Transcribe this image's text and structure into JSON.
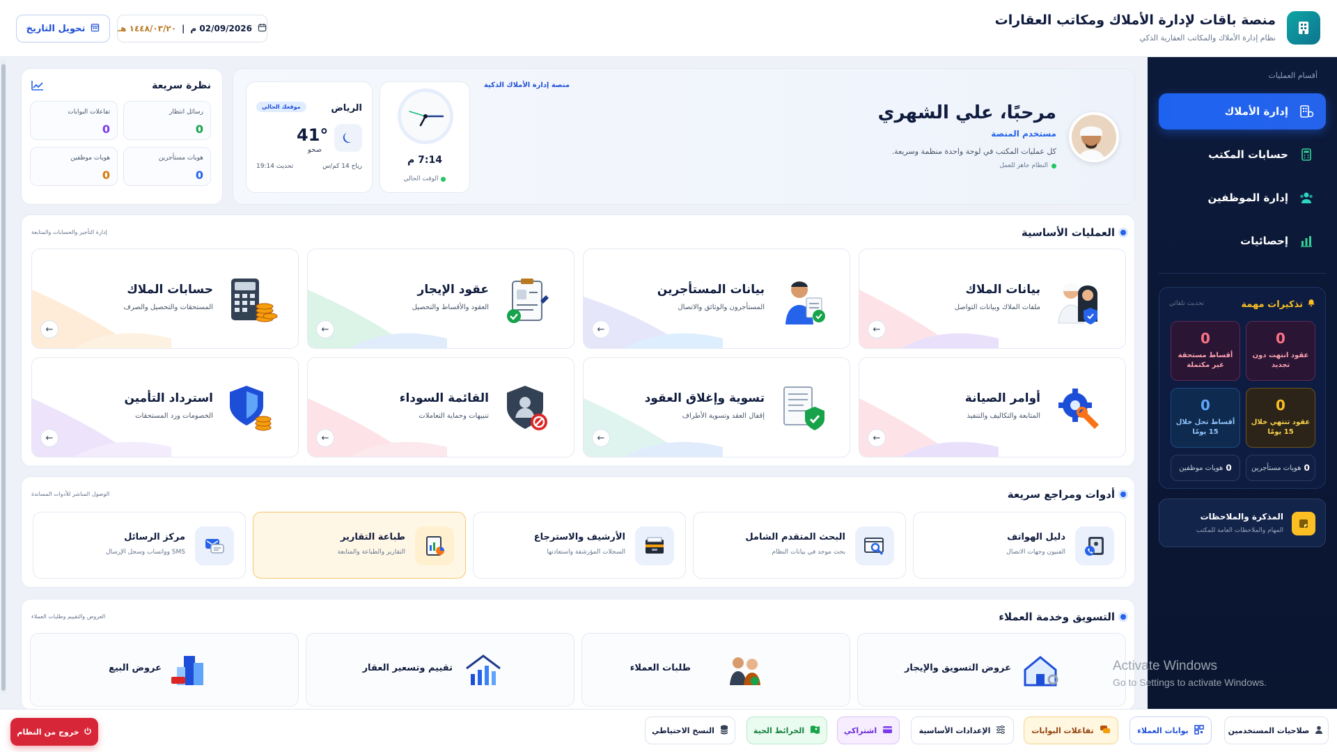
{
  "header": {
    "title": "منصة باقات لإدارة الأملاك ومكاتب العقارات",
    "subtitle": "نظام إدارة الأملاك والمكاتب العقارية الذكي",
    "date_gregorian": "02/09/2026 م",
    "date_separator": "|",
    "date_hijri": "١٤٤٨/٠٣/٢٠ هـ",
    "convert_label": "تحويل التاريخ"
  },
  "sidebar": {
    "caption": "أقسام العمليات",
    "items": [
      {
        "label": "إدارة الأملاك",
        "icon": "building-icon",
        "active": true
      },
      {
        "label": "حسابات المكتب",
        "icon": "calculator-icon",
        "active": false
      },
      {
        "label": "إدارة الموظفين",
        "icon": "users-icon",
        "active": false
      },
      {
        "label": "إحصائيات",
        "icon": "chart-icon",
        "active": false
      }
    ],
    "alerts": {
      "title": "تذكيرات مهمة",
      "note": "تحديث تلقائي",
      "boxes": [
        {
          "value": "0",
          "label": "عقود انتهت دون تجديد"
        },
        {
          "value": "0",
          "label": "أقساط مستحقة غير مكتملة"
        },
        {
          "value": "0",
          "label": "عقود تنتهي خلال 15 يومًا"
        },
        {
          "value": "0",
          "label": "أقساط تحل خلال 15 يومًا"
        }
      ],
      "mini": [
        {
          "value": "0",
          "label": "هويات مستأجرين"
        },
        {
          "value": "0",
          "label": "هويات موظفين"
        }
      ]
    },
    "notes": {
      "title": "المذكرة والملاحظات",
      "subtitle": "المهام والملاحظات العامة للمكتب"
    }
  },
  "welcome": {
    "title": "مرحبًا، علي الشهري",
    "role": "مستخدم المنصة",
    "description": "كل عمليات المكتب في لوحة واحدة منظمة وسريعة.",
    "status": "النظام جاهز للعمل",
    "platform_tag": "منصة إدارة الأملاك الذكية",
    "clock_time": "7:14 م",
    "clock_label": "الوقت الحالي",
    "weather": {
      "city": "الرياض",
      "badge": "موقعك الحالي",
      "temp": "41°",
      "condition": "صحو",
      "wind": "رياح 14 كم/س",
      "updated": "تحديث 19:14"
    }
  },
  "quick": {
    "title": "نظرة سريعة",
    "stats": [
      {
        "label": "رسائل انتظار",
        "value": "0",
        "color": "#16a34a"
      },
      {
        "label": "تفاعلات البوابات",
        "value": "0",
        "color": "#7c3aed"
      },
      {
        "label": "هويات مستأجرين",
        "value": "0",
        "color": "#2563eb"
      },
      {
        "label": "هويات موظفين",
        "value": "0",
        "color": "#d97706"
      }
    ]
  },
  "core": {
    "title": "العمليات الأساسية",
    "note": "إدارة التأجير والحسابات والمتابعة",
    "cards": [
      {
        "title": "بيانات الملاك",
        "subtitle": "ملفات الملاك وبيانات التواصل"
      },
      {
        "title": "بيانات المستأجرين",
        "subtitle": "المستأجرون والوثائق والاتصال"
      },
      {
        "title": "عقود الإيجار",
        "subtitle": "العقود والأقساط والتحصيل"
      },
      {
        "title": "حسابات الملاك",
        "subtitle": "المستحقات والتحصيل والصرف"
      },
      {
        "title": "أوامر الصيانة",
        "subtitle": "المتابعة والتكاليف والتنفيذ"
      },
      {
        "title": "تسوية وإغلاق العقود",
        "subtitle": "إقفال العقد وتسوية الأطراف"
      },
      {
        "title": "القائمة السوداء",
        "subtitle": "تنبيهات وحماية التعاملات"
      },
      {
        "title": "استرداد التأمين",
        "subtitle": "الخصومات ورد المستحقات"
      }
    ]
  },
  "tools": {
    "title": "أدوات ومراجع سريعة",
    "note": "الوصول المباشر للأدوات المساندة",
    "cards": [
      {
        "title": "دليل الهواتف",
        "subtitle": "الفنيون وجهات الاتصال"
      },
      {
        "title": "البحث المتقدم الشامل",
        "subtitle": "بحث موحد في بيانات النظام"
      },
      {
        "title": "الأرشيف والاسترجاع",
        "subtitle": "السجلات المؤرشفة واستعادتها"
      },
      {
        "title": "طباعة التقارير",
        "subtitle": "التقارير والطباعة والمتابعة"
      },
      {
        "title": "مركز الرسائل",
        "subtitle": "SMS وواتساب وسجل الإرسال"
      }
    ]
  },
  "marketing": {
    "title": "التسويق وخدمة العملاء",
    "note": "العروض والتقييم وطلبات العملاء",
    "cards": [
      {
        "title": "عروض التسويق والإيجار"
      },
      {
        "title": "طلبات العملاء"
      },
      {
        "title": "تقييم وتسعير العقار"
      },
      {
        "title": "عروض البيع"
      }
    ]
  },
  "bottombar": {
    "buttons": [
      {
        "label": "صلاحيات المستخدمين"
      },
      {
        "label": "بوابات العملاء"
      },
      {
        "label": "تفاعلات البوابات"
      },
      {
        "label": "الإعدادات الأساسية"
      },
      {
        "label": "اشتراكي"
      },
      {
        "label": "الخرائط الحية"
      },
      {
        "label": "النسخ الاحتياطي"
      }
    ],
    "logout_label": "خروج من النظام"
  },
  "watermark": {
    "line1": "Activate Windows",
    "line2": "Go to Settings to activate Windows."
  },
  "colors": {
    "primary": "#2563eb",
    "sidebar": "#0c1a3a",
    "danger": "#d72638",
    "accent": "#fbbf24"
  }
}
